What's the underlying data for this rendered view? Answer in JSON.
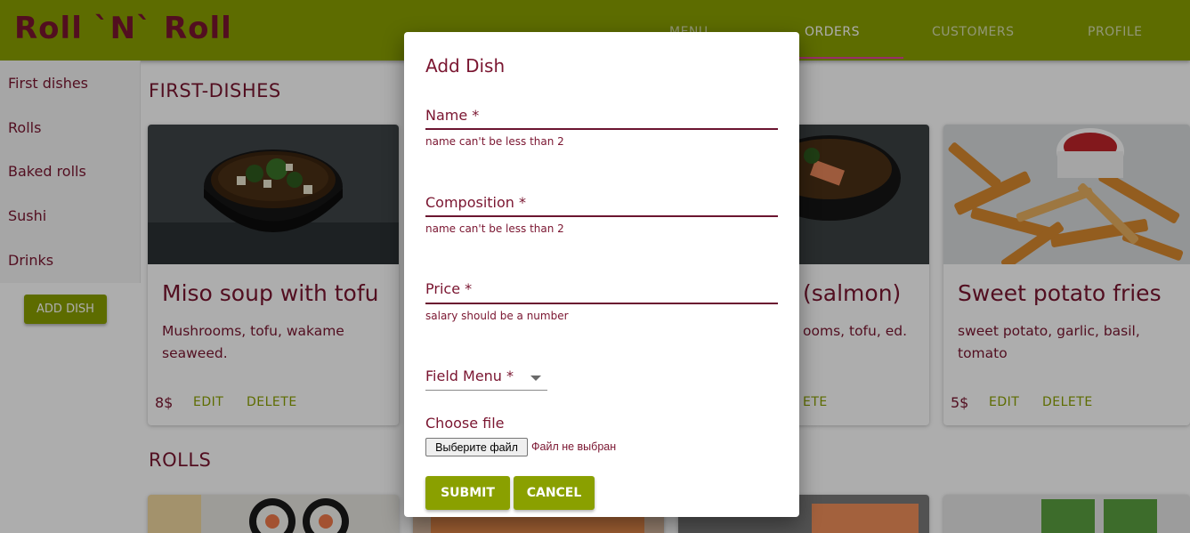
{
  "app": {
    "logo": "Roll `N` Roll"
  },
  "nav": {
    "tabs": [
      {
        "label": "MENU"
      },
      {
        "label": "ORDERS"
      },
      {
        "label": "CUSTOMERS"
      },
      {
        "label": "PROFILE"
      }
    ]
  },
  "sidebar": {
    "items": [
      {
        "label": "First dishes"
      },
      {
        "label": "Rolls"
      },
      {
        "label": "Baked rolls"
      },
      {
        "label": "Sushi"
      },
      {
        "label": "Drinks"
      }
    ],
    "add_button": "ADD DISH"
  },
  "main": {
    "sections": [
      {
        "title": "FIRST-DISHES"
      },
      {
        "title": "ROLLS"
      }
    ],
    "cards": [
      {
        "title": "Miso soup with tofu",
        "description": "Mushrooms, tofu, wakame seaweed.",
        "price": "8$",
        "edit": "EDIT",
        "delete": "DELETE"
      },
      {
        "title": "(salmon)",
        "description": "ooms, tofu, ed.",
        "price": "",
        "edit": "",
        "delete": "ETE"
      },
      {
        "title": "Sweet potato fries",
        "description": "sweet potato, garlic, basil, tomato",
        "price": "5$",
        "edit": "EDIT",
        "delete": "DELETE"
      }
    ]
  },
  "dialog": {
    "title": "Add Dish",
    "fields": [
      {
        "label": "Name *",
        "error": "name can't be less than 2"
      },
      {
        "label": "Composition *",
        "error": "name can't be less than 2"
      },
      {
        "label": "Price *",
        "error": "salary should be a number"
      }
    ],
    "select_label": "Field Menu *",
    "file_label": "Choose file",
    "file_button": "Выберите файл",
    "file_status": "Файл не выбран",
    "submit": "SUBMIT",
    "cancel": "CANCEL"
  },
  "colors": {
    "accent": "#8aa000",
    "text": "#7a1530",
    "tab_indicator": "#e0459a"
  }
}
